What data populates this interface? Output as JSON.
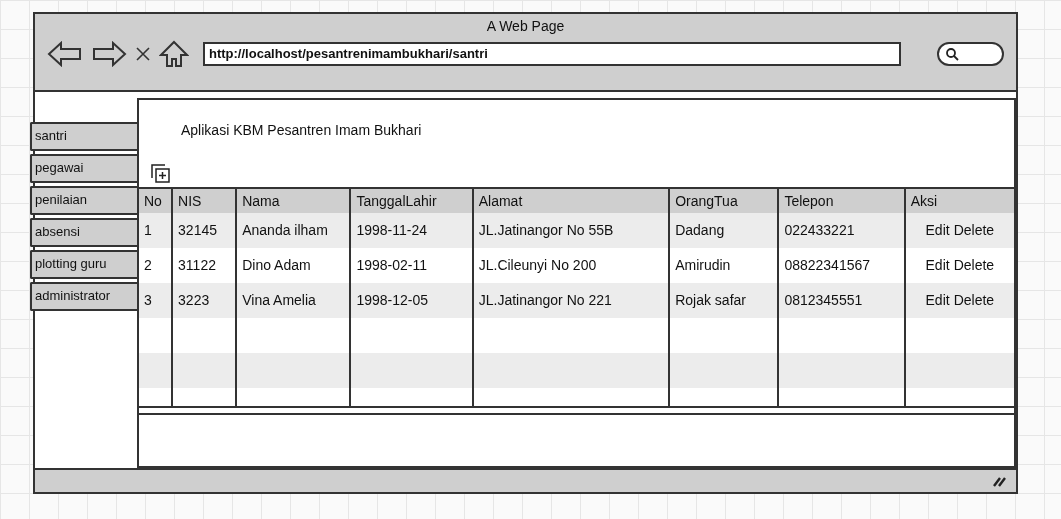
{
  "window": {
    "title": "A Web Page",
    "url": "http://localhost/pesantrenimambukhari/santri"
  },
  "sidebar": {
    "items": [
      {
        "label": "santri"
      },
      {
        "label": "pegawai"
      },
      {
        "label": "penilaian"
      },
      {
        "label": "absensi"
      },
      {
        "label": "plotting guru"
      },
      {
        "label": "administrator"
      }
    ]
  },
  "header": {
    "title": "Aplikasi KBM Pesantren Imam Bukhari"
  },
  "table": {
    "columns": [
      "No",
      "NIS",
      "Nama",
      "TanggalLahir",
      "Alamat",
      "OrangTua",
      "Telepon",
      "Aksi"
    ],
    "rows": [
      {
        "cells": [
          "1",
          "32145",
          "Ananda ilham",
          "1998-11-24",
          "JL.Jatinangor No 55B",
          "Dadang",
          "022433221"
        ],
        "actions": [
          "Edit",
          "Delete"
        ]
      },
      {
        "cells": [
          "2",
          "31122",
          "Dino Adam",
          "1998-02-11",
          "JL.Cileunyi No 200",
          "Amirudin",
          "08822341567"
        ],
        "actions": [
          "Edit",
          "Delete"
        ]
      },
      {
        "cells": [
          "3",
          "3223",
          "Vina Amelia",
          "1998-12-05",
          "JL.Jatinangor No 221",
          "Rojak safar",
          "0812345551"
        ],
        "actions": [
          "Edit",
          "Delete"
        ]
      }
    ]
  }
}
